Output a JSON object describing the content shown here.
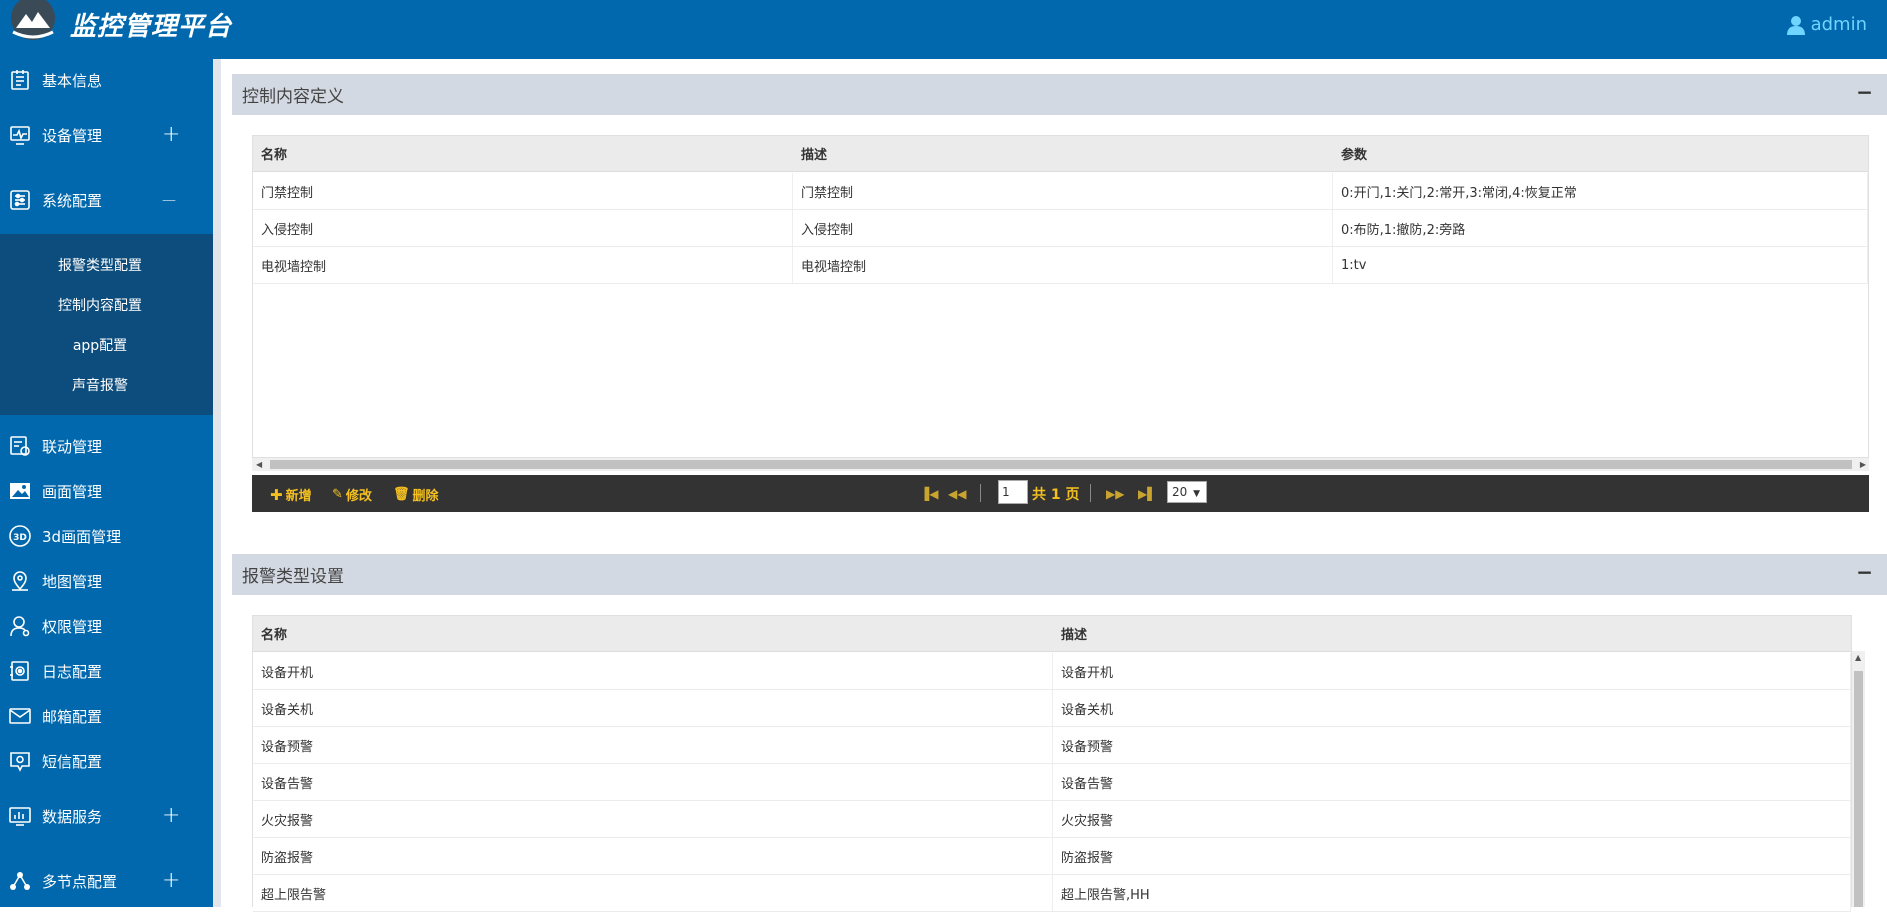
{
  "header": {
    "title": "监控管理平台",
    "user": "admin"
  },
  "sidebar": {
    "items": [
      {
        "label": "基本信息",
        "icon": "document-icon"
      },
      {
        "label": "设备管理",
        "icon": "monitor-icon",
        "toggle": "+"
      },
      {
        "label": "系统配置",
        "icon": "settings-sliders-icon",
        "toggle": "—"
      },
      {
        "label": "联动管理",
        "icon": "linkage-icon"
      },
      {
        "label": "画面管理",
        "icon": "image-icon"
      },
      {
        "label": "3d画面管理",
        "icon": "3d-icon"
      },
      {
        "label": "地图管理",
        "icon": "map-pin-icon"
      },
      {
        "label": "权限管理",
        "icon": "user-icon"
      },
      {
        "label": "日志配置",
        "icon": "log-icon"
      },
      {
        "label": "邮箱配置",
        "icon": "mail-icon"
      },
      {
        "label": "短信配置",
        "icon": "sms-icon"
      },
      {
        "label": "数据服务",
        "icon": "dashboard-icon",
        "toggle": "+"
      },
      {
        "label": "多节点配置",
        "icon": "nodes-icon",
        "toggle": "+"
      }
    ],
    "submenu": [
      "报警类型配置",
      "控制内容配置",
      "app配置",
      "声音报警"
    ]
  },
  "panel1": {
    "title": "控制内容定义",
    "collapse": "−",
    "columns": [
      "名称",
      "描述",
      "参数"
    ],
    "rows": [
      [
        "门禁控制",
        "门禁控制",
        "0:开门,1:关门,2:常开,3:常闭,4:恢复正常"
      ],
      [
        "入侵控制",
        "入侵控制",
        "0:布防,1:撤防,2:旁路"
      ],
      [
        "电视墙控制",
        "电视墙控制",
        "1:tv"
      ]
    ],
    "toolbar": {
      "add": "新增",
      "edit": "修改",
      "delete": "删除"
    },
    "pager": {
      "page": "1",
      "total": "共 1 页",
      "page_size": "20"
    }
  },
  "panel2": {
    "title": "报警类型设置",
    "collapse": "−",
    "columns": [
      "名称",
      "描述"
    ],
    "rows": [
      [
        "设备开机",
        "设备开机"
      ],
      [
        "设备关机",
        "设备关机"
      ],
      [
        "设备预警",
        "设备预警"
      ],
      [
        "设备告警",
        "设备告警"
      ],
      [
        "火灾报警",
        "火灾报警"
      ],
      [
        "防盗报警",
        "防盗报警"
      ],
      [
        "超上限告警",
        "超上限告警,HH"
      ]
    ]
  },
  "colors": {
    "brand": "#0168ad",
    "submenu": "#0d4d7d",
    "toolbar": "#333333",
    "accent": "#f4c020"
  }
}
